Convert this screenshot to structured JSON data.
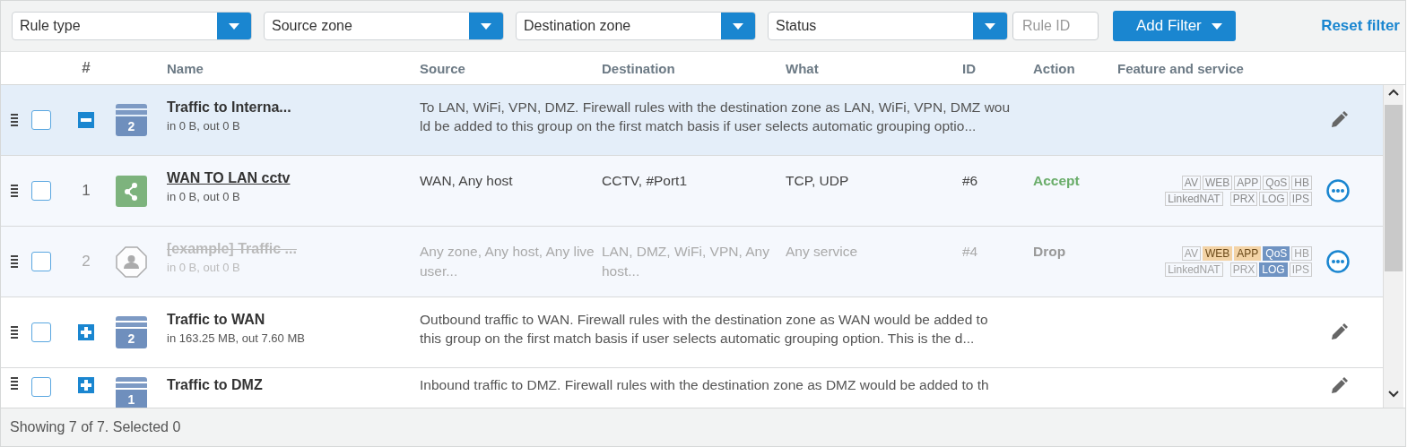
{
  "filters": {
    "dropdowns": [
      {
        "placeholder": "Rule type"
      },
      {
        "placeholder": "Source zone"
      },
      {
        "placeholder": "Destination zone"
      },
      {
        "placeholder": "Status"
      }
    ],
    "rule_id": {
      "placeholder": "Rule ID"
    },
    "add_filter": "Add Filter",
    "reset": "Reset filter"
  },
  "table": {
    "columns": [
      "#",
      "Name",
      "Source",
      "Destination",
      "What",
      "ID",
      "Action",
      "Feature and service"
    ],
    "rows": [
      {
        "kind": "group",
        "checked": false,
        "expanded": true,
        "count": "2",
        "name": "Traffic to Interna...",
        "traffic": "in 0 B, out 0 B",
        "description_lines": [
          "To LAN, WiFi, VPN, DMZ. Firewall rules with the destination zone as LAN, WiFi, VPN, DMZ wou",
          "ld be added to this group on the first match basis if user selects automatic grouping optio..."
        ]
      },
      {
        "kind": "rule",
        "checked": false,
        "disabled": false,
        "icon": {
          "kind": "network"
        },
        "number": "1",
        "name": "WAN TO LAN cctv",
        "traffic": "in 0 B, out 0 B",
        "source": "WAN, Any host",
        "destination": "CCTV, #Port1",
        "what": "TCP, UDP",
        "id": "#6",
        "action": {
          "label": "Accept",
          "kind": "accept"
        },
        "features": [
          [
            {
              "label": "AV",
              "kind": "off"
            },
            {
              "label": "WEB",
              "kind": "off"
            },
            {
              "label": "APP",
              "kind": "off"
            },
            {
              "label": "QoS",
              "kind": "off"
            },
            {
              "label": "HB",
              "kind": "off"
            }
          ],
          [
            {
              "label": "LinkedNAT",
              "kind": "off"
            },
            {
              "label": "PRX",
              "kind": "off"
            },
            {
              "label": "LOG",
              "kind": "off"
            },
            {
              "label": "IPS",
              "kind": "off"
            }
          ]
        ]
      },
      {
        "kind": "rule",
        "checked": false,
        "disabled": true,
        "icon": {
          "kind": "user"
        },
        "number": "2",
        "name": "[example] Traffic ...",
        "traffic": "in 0 B, out 0 B",
        "source": "Any zone, Any host, Any live user...",
        "destination": "LAN, DMZ, WiFi, VPN, Any host...",
        "what": "Any service",
        "id": "#4",
        "action": {
          "label": "Drop",
          "kind": "drop"
        },
        "features": [
          [
            {
              "label": "AV",
              "kind": "off"
            },
            {
              "label": "WEB",
              "kind": "partial"
            },
            {
              "label": "APP",
              "kind": "partial"
            },
            {
              "label": "QoS",
              "kind": "on"
            },
            {
              "label": "HB",
              "kind": "off"
            }
          ],
          [
            {
              "label": "LinkedNAT",
              "kind": "off"
            },
            {
              "label": "PRX",
              "kind": "off"
            },
            {
              "label": "LOG",
              "kind": "on"
            },
            {
              "label": "IPS",
              "kind": "off"
            }
          ]
        ]
      },
      {
        "kind": "group",
        "checked": false,
        "expanded": false,
        "count": "2",
        "name": "Traffic to WAN",
        "traffic": "in 163.25 MB, out 7.60 MB",
        "description_lines": [
          "Outbound traffic to WAN. Firewall rules with the destination zone as WAN would be added to",
          "this group on the first match basis if user selects automatic grouping option. This is the d..."
        ]
      },
      {
        "kind": "group",
        "checked": false,
        "expanded": false,
        "count": "1",
        "name": "Traffic to DMZ",
        "description_lines": [
          "Inbound traffic to DMZ. Firewall rules with the destination zone as DMZ would be added to th"
        ]
      }
    ]
  },
  "status_bar": "Showing 7 of 7. Selected 0"
}
